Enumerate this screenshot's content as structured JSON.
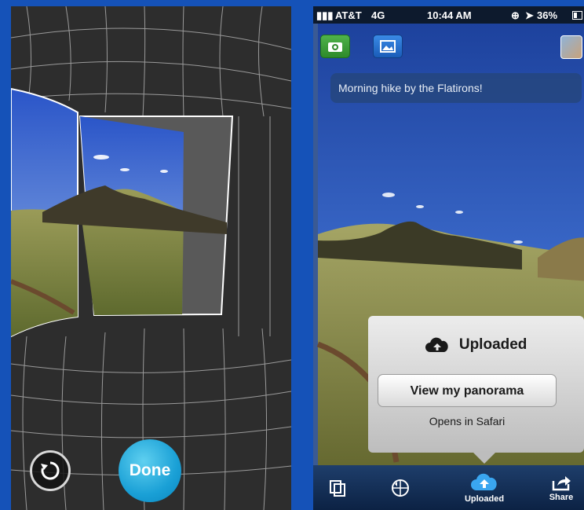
{
  "left": {
    "done_label": "Done",
    "icons": [
      "undo-icon"
    ]
  },
  "right": {
    "status": {
      "carrier": "AT&T",
      "network": "4G",
      "time": "10:44 AM",
      "battery": "36%"
    },
    "caption": "Morning hike by the Flatirons!",
    "popup": {
      "title": "Uploaded",
      "button_label": "View my panorama",
      "note": "Opens in Safari"
    },
    "tabs": [
      {
        "label": "",
        "icon": "pages-icon"
      },
      {
        "label": "",
        "icon": "panorama-icon"
      },
      {
        "label": "Uploaded",
        "icon": "cloud-upload-icon"
      },
      {
        "label": "Share",
        "icon": "share-icon"
      }
    ]
  },
  "colors": {
    "background": "#1552b8",
    "done_button": "#1aa0d6",
    "camera_button": "#4fb34a",
    "gallery_button": "#3a8be6"
  }
}
